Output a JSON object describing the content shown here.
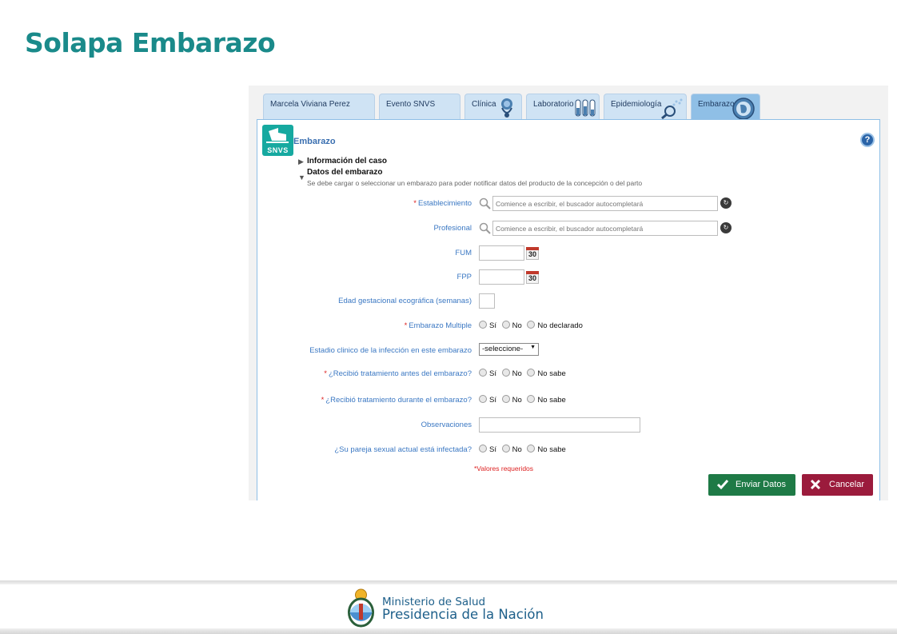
{
  "slide": {
    "title": "Solapa Embarazo"
  },
  "tabs": [
    {
      "label": "Marcela Viviana Perez"
    },
    {
      "label": "Evento SNVS"
    },
    {
      "label": "Clínica"
    },
    {
      "label": "Laboratorio"
    },
    {
      "label": "Epidemiología"
    },
    {
      "label": "Embarazo"
    }
  ],
  "panel": {
    "logo_text": "SNVS",
    "title": "Embarazo",
    "help": "?"
  },
  "sections": {
    "case_info": "Información del caso",
    "pregnancy_data": "Datos del embarazo",
    "pregnancy_note": "Se debe cargar o seleccionar un embarazo para poder notificar datos del producto de la concepción o del parto"
  },
  "form": {
    "establecimiento": {
      "label": "Establecimiento",
      "placeholder": "Comience a escribir, el buscador autocompletará"
    },
    "profesional": {
      "label": "Profesional",
      "placeholder": "Comience a escribir, el buscador autocompletará"
    },
    "fum": {
      "label": "FUM"
    },
    "fpp": {
      "label": "FPP"
    },
    "calendar_day": "30",
    "edad_gestacional": {
      "label": "Edad gestacional ecográfica (semanas)"
    },
    "embarazo_multiple": {
      "label": "Embarazo Multiple",
      "options": [
        "Sí",
        "No",
        "No declarado"
      ]
    },
    "estadio_clinico": {
      "label": "Estadio clinico de la infección en este embarazo",
      "selected": "-seleccione-"
    },
    "tratamiento_antes": {
      "label": "¿Recibió tratamiento antes del embarazo?",
      "options": [
        "Sí",
        "No",
        "No sabe"
      ]
    },
    "tratamiento_durante": {
      "label": "¿Recibió tratamiento durante el embarazo?",
      "options": [
        "Sí",
        "No",
        "No sabe"
      ]
    },
    "observaciones": {
      "label": "Observaciones"
    },
    "pareja": {
      "label": "¿Su pareja sexual actual está infectada?",
      "options": [
        "Sí",
        "No",
        "No sabe"
      ]
    },
    "required_marker": "*",
    "required_note": "*Valores requeridos"
  },
  "buttons": {
    "send": "Enviar Datos",
    "cancel": "Cancelar"
  },
  "footer": {
    "line1": "Ministerio de Salud",
    "line2": "Presidencia de la Nación"
  },
  "colors": {
    "title_teal": "#1a8a8a",
    "label_blue": "#3b78c3",
    "send_green": "#1e7a46",
    "cancel_red": "#9b1b3c",
    "required_red": "#dd2222"
  }
}
